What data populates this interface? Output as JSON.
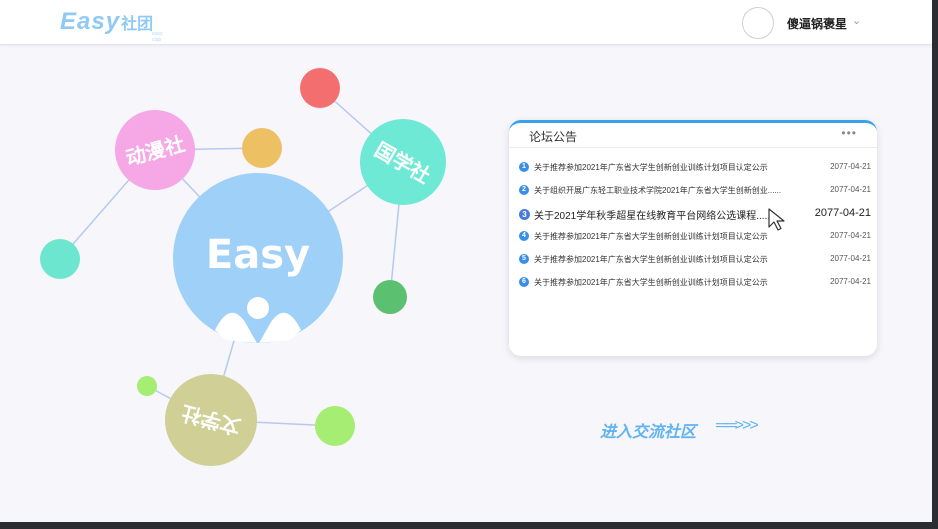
{
  "header": {
    "logo_text": "Easy",
    "logo_cn": "社团",
    "logo_sub": "easy club",
    "username": "傻逼锅褒星",
    "chevron": "⌄"
  },
  "bubbles": {
    "center_label": "Easy",
    "club_top_right": "国学社",
    "club_bottom": "文学社",
    "club_top_left": "动漫社"
  },
  "forum": {
    "title": "论坛公告",
    "more": "•••",
    "notices": [
      {
        "num": "1",
        "title": "关于推荐参加2021年广东省大学生创新创业训练计划项目认定公示",
        "date": "2077-04-21"
      },
      {
        "num": "2",
        "title": "关于组织开展广东轻工职业技术学院2021年广东省大学生创新创业......",
        "date": "2077-04-21"
      },
      {
        "num": "3",
        "title": "关于2021学年秋季超星在线教育平台网络公选课程......",
        "date": "2077-04-21"
      },
      {
        "num": "4",
        "title": "关于推荐参加2021年广东省大学生创新创业训练计划项目认定公示",
        "date": "2077-04-21"
      },
      {
        "num": "5",
        "title": "关于推荐参加2021年广东省大学生创新创业训练计划项目认定公示",
        "date": "2077-04-21"
      },
      {
        "num": "6",
        "title": "关于推荐参加2021年广东省大学生创新创业训练计划项目认定公示",
        "date": "2077-04-21"
      }
    ]
  },
  "community": {
    "label": "进入交流社区",
    "arrow": "══>>>"
  },
  "colors": {
    "accent": "#3aa0ea",
    "center_bubble": "#9fd0f7",
    "red_bubble": "#f36e6e",
    "pink_bubble": "#f6a7e6",
    "orange_bubble": "#eec064",
    "mint_bubble": "#6de6d0",
    "cyan_bubble": "#6ee9d6",
    "green_bubble": "#5bc06f",
    "olive_bubble": "#cfcf96",
    "lime_bubble": "#a5ed73"
  }
}
